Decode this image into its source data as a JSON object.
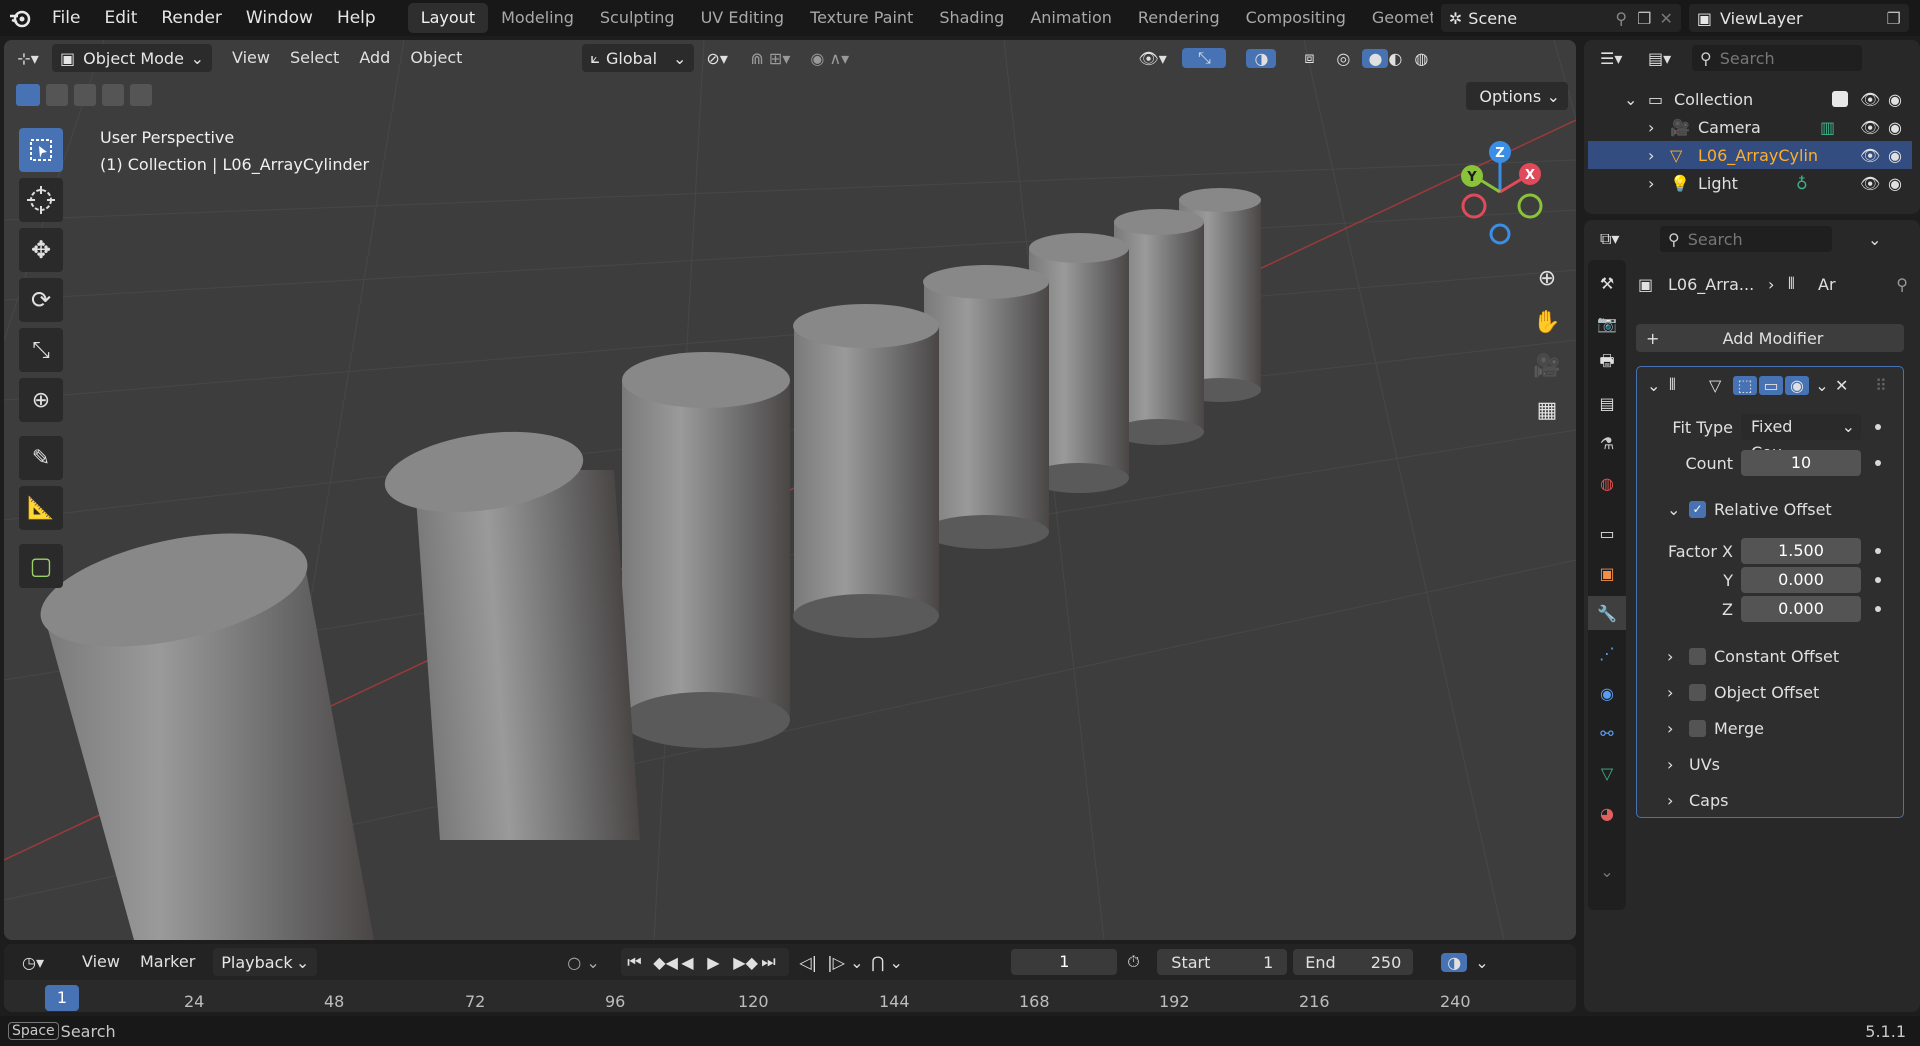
{
  "topbar": {
    "menus": [
      "File",
      "Edit",
      "Render",
      "Window",
      "Help"
    ],
    "workspaces": [
      "Layout",
      "Modeling",
      "Sculpting",
      "UV Editing",
      "Texture Paint",
      "Shading",
      "Animation",
      "Rendering",
      "Compositing",
      "Geometr"
    ],
    "active_workspace": "Layout",
    "scene": "Scene",
    "view_layer": "ViewLayer"
  },
  "viewport_header": {
    "mode": "Object Mode",
    "menus": [
      "View",
      "Select",
      "Add",
      "Object"
    ],
    "transform_orientation": "Global",
    "options_label": "Options"
  },
  "viewport": {
    "perspective_label": "User Perspective",
    "context_label": "(1) Collection | L06_ArrayCylinder",
    "gizmo_axes": {
      "x": "X",
      "y": "Y",
      "z": "Z"
    }
  },
  "outliner": {
    "search_placeholder": "Search",
    "collection": "Collection",
    "items": [
      {
        "label": "Camera",
        "icon": "camera-icon"
      },
      {
        "label": "L06_ArrayCylin",
        "icon": "mesh-icon"
      },
      {
        "label": "Light",
        "icon": "light-icon"
      }
    ]
  },
  "properties": {
    "search_placeholder": "Search",
    "breadcrumb_object": "L06_Arra...",
    "breadcrumb_modifier": "Ar",
    "add_modifier": "Add Modifier",
    "fit_type_label": "Fit Type",
    "fit_type_value": "Fixed Cou...",
    "count_label": "Count",
    "count_value": "10",
    "relative_offset": "Relative Offset",
    "factor_x_label": "Factor X",
    "factor_x": "1.500",
    "y_label": "Y",
    "factor_y": "0.000",
    "z_label": "Z",
    "factor_z": "0.000",
    "constant_offset": "Constant Offset",
    "object_offset": "Object Offset",
    "merge": "Merge",
    "uvs": "UVs",
    "caps": "Caps"
  },
  "timeline": {
    "menus": [
      "View",
      "Marker"
    ],
    "playback": "Playback",
    "current_frame": "1",
    "start_label": "Start",
    "start": "1",
    "end_label": "End",
    "end": "250",
    "ticks": [
      "1",
      "24",
      "48",
      "72",
      "96",
      "120",
      "144",
      "168",
      "192",
      "216",
      "240"
    ]
  },
  "status": {
    "key": "Space",
    "action": "Search",
    "version": "5.1.1"
  },
  "colors": {
    "accent": "#4772b3",
    "x_axis": "#e04a5a",
    "y_axis": "#8ac23a",
    "z_axis": "#3a8ee6",
    "selected_text": "#ffaf29"
  }
}
